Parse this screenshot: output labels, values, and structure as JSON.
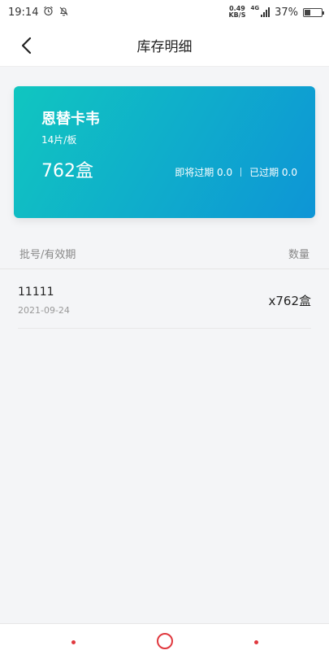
{
  "status_bar": {
    "time": "19:14",
    "net_speed_value": "0.49",
    "net_speed_unit": "KB/S",
    "network_type": "4G",
    "battery_percent": "37%",
    "battery_level": 0.37
  },
  "nav": {
    "title": "库存明细"
  },
  "card": {
    "drug_name": "恩替卡韦",
    "spec": "14片/板",
    "quantity": "762盒",
    "expiring_soon": "即将过期 0.0",
    "expired": "已过期 0.0",
    "gradient_start": "#10c6c0",
    "gradient_end": "#0e95d6"
  },
  "table": {
    "col_batch": "批号/有效期",
    "col_qty": "数量",
    "rows": [
      {
        "batch": "11111",
        "expiry": "2021-09-24",
        "qty": "x762盒"
      }
    ]
  },
  "system_nav": {
    "accent_color": "#e0383e"
  }
}
